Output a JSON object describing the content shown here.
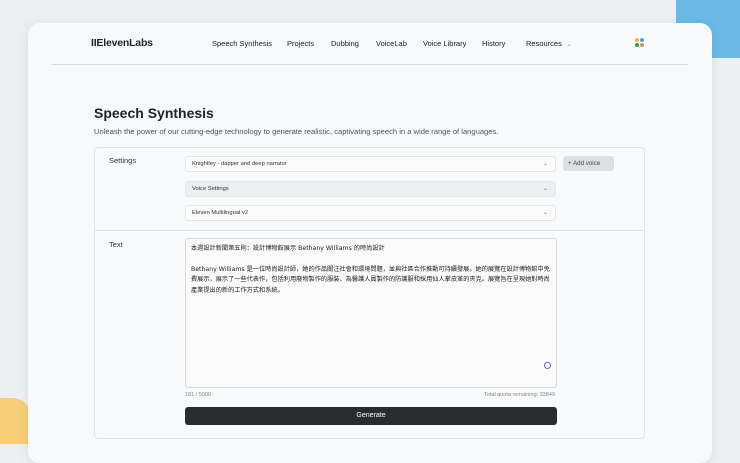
{
  "nav": {
    "logo": "IIElevenLabs",
    "items": [
      "Speech Synthesis",
      "Projects",
      "Dubbing",
      "VoiceLab",
      "Voice Library",
      "History",
      "Resources"
    ]
  },
  "page": {
    "title": "Speech Synthesis",
    "subtitle": "Unleash the power of our cutting-edge technology to generate realistic, captivating speech in a wide range of languages."
  },
  "settings": {
    "label": "Settings",
    "voice": "Knightley - dapper and deep narrator",
    "add_voice": "Add voice",
    "voice_settings": "Voice Settings",
    "model": "Eleven Multilingual v2"
  },
  "text": {
    "label": "Text",
    "line1": "本週設計新聞第五則：設計博物館展示 Bethany Williams 的時尚設計",
    "line2": "Bethany Williams 是一位時尚設計師，她的作品關注社會和環境問題，並與社區合作推動可持續發展。她的展覽在設計博物館中免費展示，展示了一些代表作，包括利用廢物製作的服裝、為醫護人員製作的防護服和採用仙人掌皮革的夾克。展覽旨在呈現她對時尚產業提出的新的工作方式和系統。",
    "count": "181 / 5000",
    "quota": "Total quota remaining: 33849",
    "generate": "Generate"
  }
}
